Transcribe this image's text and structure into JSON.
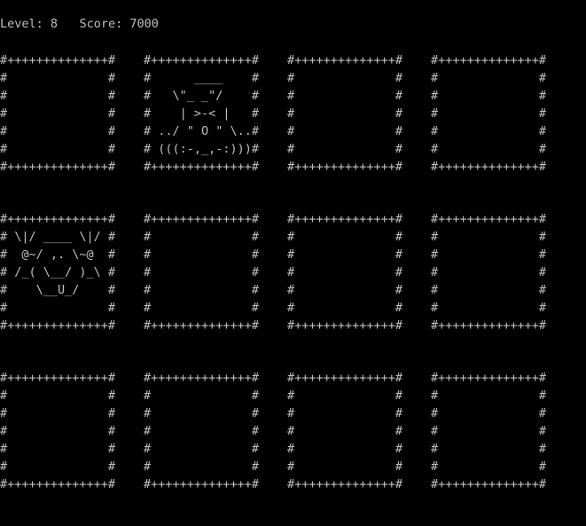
{
  "status": {
    "level_label": "Level:",
    "level_value": "8",
    "score_label": "Score:",
    "score_value": "7000"
  },
  "board": {
    "card_frame": "#++++++++++++++#\n#              #\n#              #\n#              #\n#              #\n#              #\n#++++++++++++++#",
    "rows": [
      {
        "cards": [
          {
            "art": ""
          },
          {
            "art": "       ____\n    \\\"_ _\"/\n     | >-< |\n  ../ \" O \" \\..\n  (((:-,_,-:)))"
          },
          {
            "art": ""
          },
          {
            "art": ""
          }
        ]
      },
      {
        "cards": [
          {
            "art": "  \\|/ ____ \\|/\n   @~/ ,. \\~@\n  /_( \\__/ )_\\\n     \\__U_/"
          },
          {
            "art": ""
          },
          {
            "art": ""
          },
          {
            "art": ""
          }
        ]
      },
      {
        "cards": [
          {
            "art": ""
          },
          {
            "art": ""
          },
          {
            "art": ""
          },
          {
            "art": ""
          }
        ]
      }
    ]
  }
}
